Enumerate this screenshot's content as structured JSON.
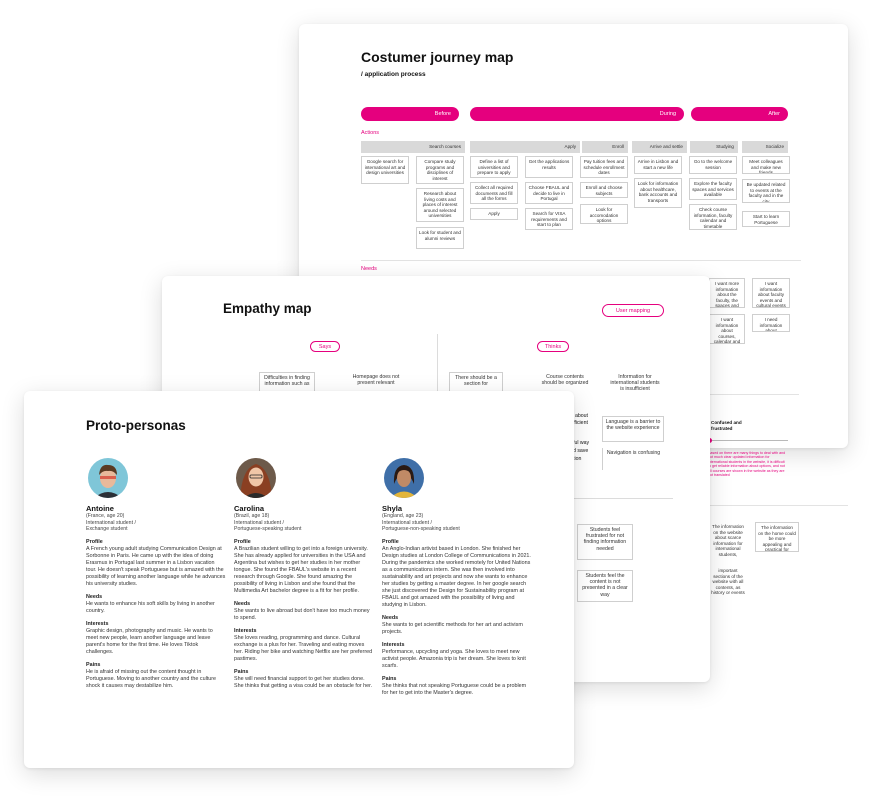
{
  "journey": {
    "title": "Costumer journey map",
    "subtitle": "/ application process",
    "phases": [
      "Before",
      "During",
      "After"
    ],
    "section_actions": "Actions",
    "section_needs": "Needs",
    "headers": [
      "Search courses",
      "Apply",
      "Enroll",
      "Arrive and settle",
      "Studying",
      "Socialize"
    ],
    "notes": {
      "n1": "Google search for international art and design universities",
      "n2": "Compare study programs and disciplines of interest",
      "n3": "Research about living costs and places of interest around selected universities",
      "n4": "Look for student and alumni reviews",
      "n5": "Define a list of universities and prepare to apply",
      "n6": "Get the applications results",
      "n7": "Collect all required documents and fill all the forms",
      "n8": "Choose FBAUL and decide to live in Portugal",
      "n9": "Apply",
      "n10": "Search for VISA requirements and start to plan",
      "n11": "Pay tuition fees and schedule enrollment dates",
      "n12": "Enroll and choose subjects",
      "n13": "Look for accomodation options",
      "n14": "Arrive in Lisbon and start a new life",
      "n15": "Look for information about healthcare, bank accounts and transports",
      "n16": "Go to the welcome session",
      "n17": "Explore the faculty spaces and services available",
      "n18": "Check course information, faculty calendar and timetable",
      "n19": "Meet colleagues and make new friends",
      "n20": "Be updated related to events at the faculty and in the city",
      "n21": "Start to learn Portuguese",
      "n22": "I want more information about the faculty, the spaces and services",
      "n23": "I want information about faculty events and cultural events in the city",
      "n24": "I want information about courses, calendar and timetable",
      "n25": "I need information about Portuguese language courses",
      "n26": "Confused and frustrated",
      "n27": "Based on there are many things to deal with and not much clear updated information for international students in the website, it is difficult to get reliable information about options, and not all courses are shown in the website as they are not translated",
      "n28": "The information on the website about scarce information for international students, regarding the university",
      "n29": "The information on the home could be more appealing and practical for students",
      "n30": "important sections of the website with all contents, as history or events that are not translated"
    }
  },
  "empathy": {
    "title": "Empathy map",
    "pill_user": "User mapping",
    "says": "Says",
    "thinks": "Thinks",
    "notes": {
      "e1": "Difficulties in finding information such as",
      "e2": "Homepage does not present relevant",
      "e3": "There should be a section for",
      "e4": "Course contents should be organized",
      "e5": "Information for international students is insufficient",
      "e6": "Language is a barrier to the website experience",
      "e7": "Navigation is confusing",
      "e8": "Students feel frustrated for not finding information needed",
      "e9": "Students feel the content is not presented in a clear way",
      "p1": "about",
      "p2": "fficient",
      "p3": "ful way",
      "p4": "d save",
      "p5": "tion"
    }
  },
  "personas": {
    "title": "Proto-personas",
    "list": [
      {
        "name": "Antoine",
        "origin": "(France, age 20)",
        "tag1": "International student /",
        "tag2": "Exchange student",
        "profile_h": "Profile",
        "profile": "A French young adult studying Communication Design at Sorbonne in Paris. He came up with the idea of doing Erasmus in Portugal last summer in a Lisbon vacation tour. He doesn't speak Portuguese but is amazed with the possibility of learning another language while he advances his university studies.",
        "needs_h": "Needs",
        "needs": "He wants to enhance his soft skills by living in another country.",
        "interests_h": "Interests",
        "interests": "Graphic design, photography and music. He wants to meet new people, learn another language and leave parent's home for the first time. He loves Tiktok challenges.",
        "pains_h": "Pains",
        "pains": "He is afraid of missing out the content thought in Portuguese. Moving to another country and the culture shock it causes may destabilize him."
      },
      {
        "name": "Carolina",
        "origin": "(Brazil, age 18)",
        "tag1": "International student /",
        "tag2": "Portuguese-speaking student",
        "profile_h": "Profile",
        "profile": "A Brazilian student willing to get into a foreign university. She has already applied for universities in the USA and Argentina but wishes to get her studies in her mother tongue. She found the FBAUL's website in a recent research through Google. She found amazing the possibility of living in Lisbon and she found that the Multimedia Art bachelor degree is a fit for her profile.",
        "needs_h": "Needs",
        "needs": "She wants to live abroad but don't have too much money to spend.",
        "interests_h": "Interests",
        "interests": "She loves reading, programming and dance. Cultural exchange is a plus for her. Traveling and eating moves her. Riding her bike and watching Netflix are her preferred pastimes.",
        "pains_h": "Pains",
        "pains": "She will need financial support to get her studies done. She thinks that getting a visa could be an obstacle for her."
      },
      {
        "name": "Shyla",
        "origin": "(England, age 23)",
        "tag1": "International student /",
        "tag2": "Portuguese-non-speaking student",
        "profile_h": "Profile",
        "profile": "An Anglo-Indian artivist based in London. She finished her Design studies at London College of Communications in 2021. During the pandemics she worked remotely for United Nations as a communications intern. She was then involved into sustainability and art projects and now she wants to enhance her studies by getting a master degree. In her google search she just discovered the Design for Sustainability program at FBAUL and got amazed with the possibility of living and studying in Lisbon.",
        "needs_h": "Needs",
        "needs": "She wants to get scientific methods for her art and activism projects.",
        "interests_h": "Interests",
        "interests": "Performance, upcycling and yoga. She loves to meet new activist people. Amazonia trip is her dream. She loves to knit scarfs.",
        "pains_h": "Pains",
        "pains": "She thinks that not speaking Portuguese could be a problem for her to get into the Master's degree."
      }
    ]
  },
  "colors": {
    "accent": "#e5007e"
  }
}
